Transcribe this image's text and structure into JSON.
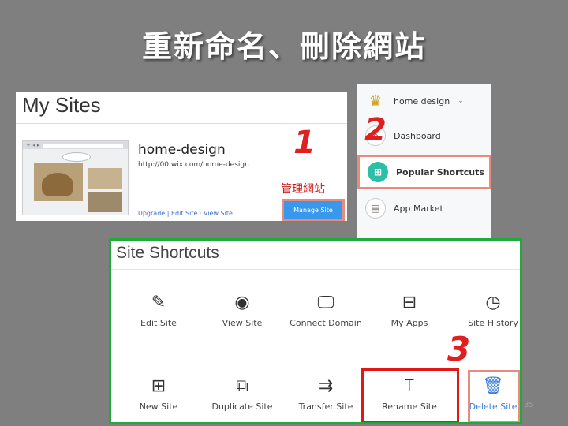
{
  "slide": {
    "title": "重新命名、刪除網站",
    "page_number": "35"
  },
  "steps": {
    "one": "1",
    "two": "2",
    "three": "3"
  },
  "my_sites": {
    "heading": "My Sites",
    "site_name": "home-design",
    "site_url": "http://00.wix.com/home-design",
    "links": {
      "upgrade": "Upgrade",
      "edit_site": "Edit Site",
      "view_site": "View Site"
    },
    "manage_label": "管理網站",
    "manage_button": "Manage Site"
  },
  "side_menu": {
    "site_selector": "home design",
    "items": [
      {
        "label": "Dashboard",
        "icon": "house-icon"
      },
      {
        "label": "Popular Shortcuts",
        "icon": "grid-icon"
      },
      {
        "label": "App Market",
        "icon": "store-icon"
      }
    ]
  },
  "site_shortcuts": {
    "heading": "Site Shortcuts",
    "row1": [
      {
        "label": "Edit Site",
        "icon": "pencil-icon"
      },
      {
        "label": "View Site",
        "icon": "eye-icon"
      },
      {
        "label": "Connect Domain",
        "icon": "www-monitor-icon"
      },
      {
        "label": "My Apps",
        "icon": "briefcase-icon"
      },
      {
        "label": "Site History",
        "icon": "clock-icon"
      }
    ],
    "row2": [
      {
        "label": "New Site",
        "icon": "monitor-plus-icon"
      },
      {
        "label": "Duplicate Site",
        "icon": "duplicate-monitor-icon"
      },
      {
        "label": "Transfer Site",
        "icon": "transfer-monitor-icon"
      },
      {
        "label": "Rename Site",
        "icon": "rename-icon"
      },
      {
        "label": "Delete Site",
        "icon": "trash-icon"
      }
    ]
  },
  "colors": {
    "highlight_red": "#e01818",
    "highlight_salmon": "#e88a7e",
    "panel_border_green": "#1faa3a",
    "accent_blue": "#3899ec"
  }
}
